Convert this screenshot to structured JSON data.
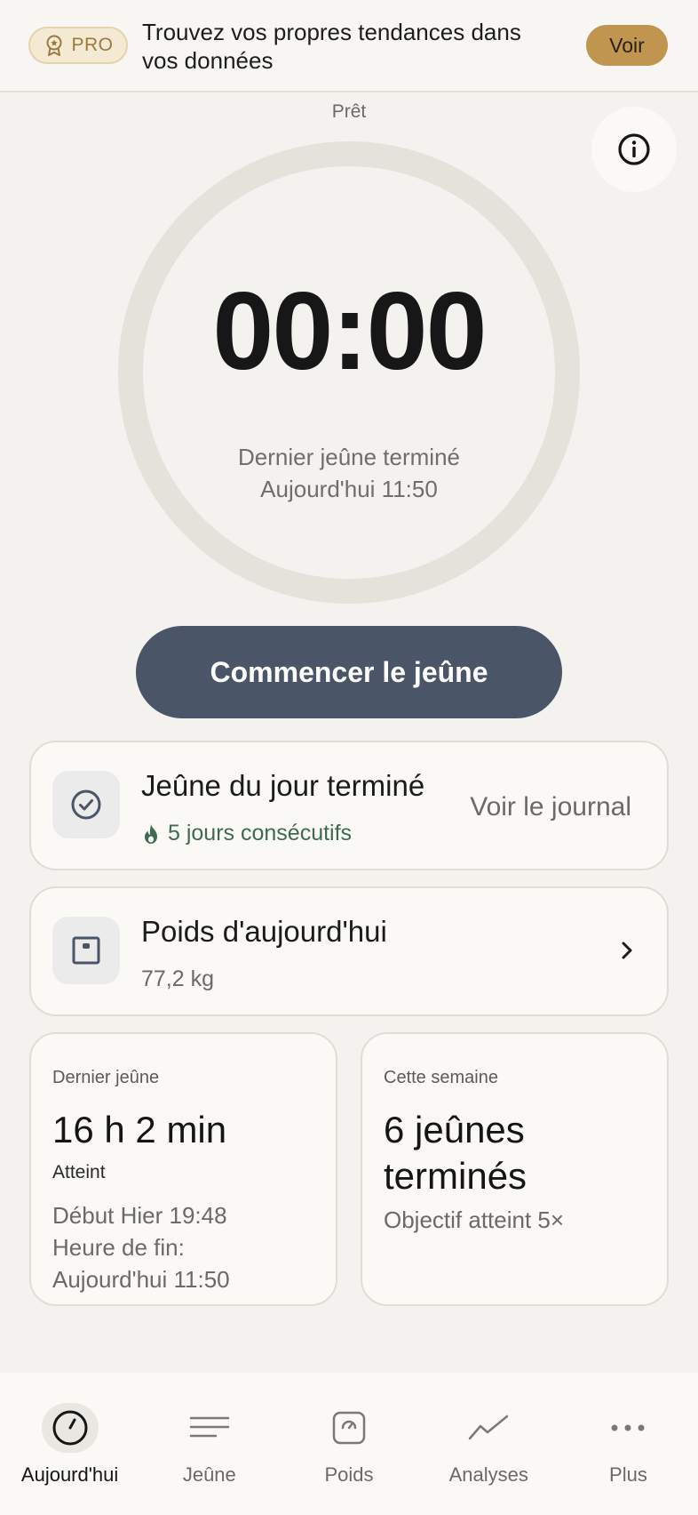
{
  "banner": {
    "badge_label": "PRO",
    "text": "Trouvez vos propres tendances dans vos données",
    "button_label": "Voir"
  },
  "timer": {
    "status": "Prêt",
    "time": "00:00",
    "last_fast_title": "Dernier jeûne terminé",
    "last_fast_time": "Aujourd'hui 11:50"
  },
  "start_button": {
    "label": "Commencer le jeûne"
  },
  "daily_card": {
    "title": "Jeûne du jour terminé",
    "streak": "5 jours consécutifs",
    "link": "Voir le journal"
  },
  "weight_card": {
    "title": "Poids d'aujourd'hui",
    "value": "77,2 kg"
  },
  "last_fast_card": {
    "label": "Dernier jeûne",
    "value": "16 h 2 min",
    "status": "Atteint",
    "start": "Début Hier 19:48",
    "end_label": "Heure de fin:",
    "end_value": "Aujourd'hui 11:50"
  },
  "week_card": {
    "label": "Cette semaine",
    "value": "6 jeûnes terminés",
    "goal": "Objectif atteint 5×"
  },
  "nav": {
    "items": [
      {
        "label": "Aujourd'hui",
        "icon": "clock-icon",
        "active": true
      },
      {
        "label": "Jeûne",
        "icon": "lines-icon",
        "active": false
      },
      {
        "label": "Poids",
        "icon": "scale-icon",
        "active": false
      },
      {
        "label": "Analyses",
        "icon": "trend-icon",
        "active": false
      },
      {
        "label": "Plus",
        "icon": "more-dots-icon",
        "active": false
      }
    ]
  },
  "colors": {
    "background": "#f4f2ee",
    "primary_button": "#4a5568",
    "accent_gold": "#bf9550",
    "streak_green": "#3e6b4f",
    "ring": "#e5e2db"
  }
}
